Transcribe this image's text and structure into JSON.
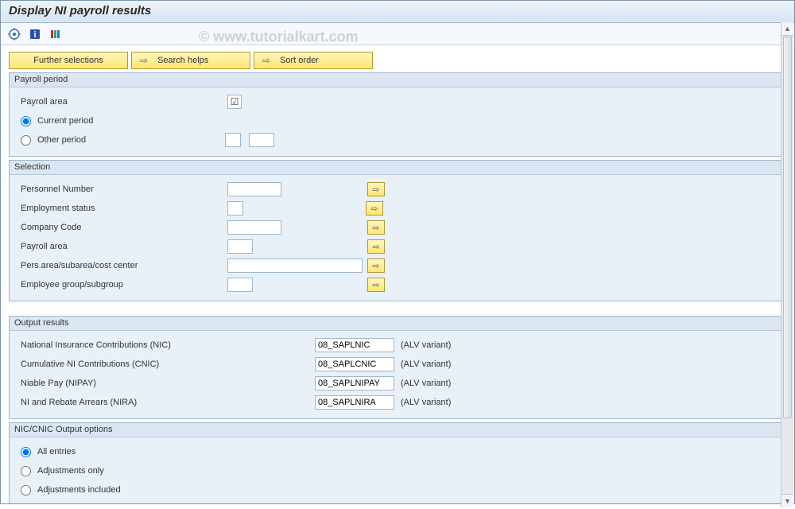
{
  "title": "Display NI payroll results",
  "watermark": "© www.tutorialkart.com",
  "buttons": {
    "further_selections": "Further selections",
    "search_helps": "Search helps",
    "sort_order": "Sort order"
  },
  "groups": {
    "payroll_period": {
      "title": "Payroll period",
      "payroll_area_label": "Payroll area",
      "current_period_label": "Current period",
      "other_period_label": "Other period",
      "payroll_area_checked": "☑",
      "period_selected": "current"
    },
    "selection": {
      "title": "Selection",
      "rows": [
        {
          "label": "Personnel Number",
          "width": "w-60"
        },
        {
          "label": "Employment status",
          "width": "w-short"
        },
        {
          "label": "Company Code",
          "width": "w-60"
        },
        {
          "label": "Payroll area",
          "width": "w-30"
        },
        {
          "label": "Pers.area/subarea/cost center",
          "width": "w-150"
        },
        {
          "label": "Employee group/subgroup",
          "width": "w-30"
        }
      ]
    },
    "output_results": {
      "title": "Output results",
      "suffix": "(ALV variant)",
      "rows": [
        {
          "label": "National Insurance Contributions (NIC)",
          "value": "08_SAPLNIC"
        },
        {
          "label": "Cumulative NI Contributions (CNIC)",
          "value": "08_SAPLCNIC"
        },
        {
          "label": "Niable Pay (NIPAY)",
          "value": "08_SAPLNIPAY"
        },
        {
          "label": "NI and Rebate Arrears (NIRA)",
          "value": "08_SAPLNIRA"
        }
      ]
    },
    "nic_cnic": {
      "title": "NIC/CNIC Output options",
      "options": [
        "All entries",
        "Adjustments only",
        "Adjustments included"
      ],
      "selected": 0
    }
  }
}
